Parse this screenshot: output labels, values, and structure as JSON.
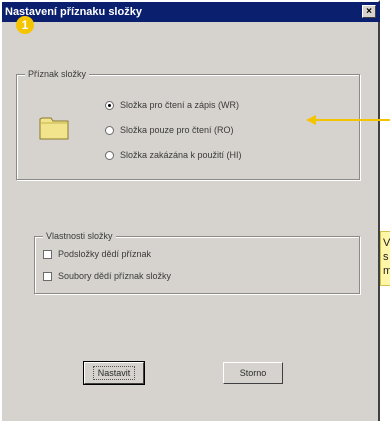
{
  "window": {
    "title": "Nastavení příznaku složky",
    "close_glyph": "×"
  },
  "step_badge": "1",
  "flag_group": {
    "title": "Příznak složky",
    "icon": "folder-icon",
    "options": [
      {
        "label": "Složka pro čtení a zápis (WR)",
        "checked": true
      },
      {
        "label": "Složka pouze pro čtení (RO)",
        "checked": false
      },
      {
        "label": "Složka zakázána k použití (HI)",
        "checked": false
      }
    ]
  },
  "props_group": {
    "title": "Vlastnosti složky",
    "options": [
      {
        "label": "Podsložky dědí příznak",
        "checked": false
      },
      {
        "label": "Soubory dědí příznak složky",
        "checked": false
      }
    ]
  },
  "buttons": {
    "set": "Nastavit",
    "cancel": "Storno"
  },
  "note": {
    "lines": [
      "V",
      "s",
      "m"
    ]
  },
  "colors": {
    "titlebar": "#0a1f6e",
    "dialog": "#d6d3ce",
    "badge": "#f5c400",
    "arrow": "#f5c400",
    "note": "#fff6a8"
  }
}
